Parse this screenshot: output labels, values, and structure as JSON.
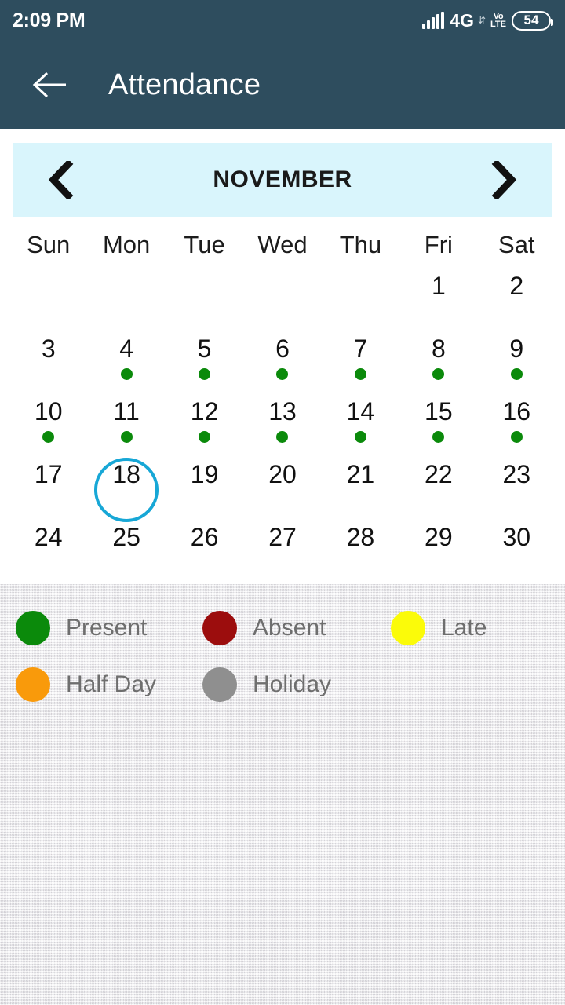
{
  "status_bar": {
    "time": "2:09 PM",
    "network_type": "4G",
    "volte_top": "Vo",
    "volte_bottom": "LTE",
    "battery_level": "54",
    "signal_icon": "signal-bars-icon",
    "data_arrows_icon": "data-transfer-icon"
  },
  "app_bar": {
    "title": "Attendance",
    "back_icon": "back-arrow-icon"
  },
  "calendar": {
    "month_label": "NOVEMBER",
    "prev_icon": "chevron-left-icon",
    "next_icon": "chevron-right-icon",
    "weekdays": [
      "Sun",
      "Mon",
      "Tue",
      "Wed",
      "Thu",
      "Fri",
      "Sat"
    ],
    "today": 18,
    "today_ring_color": "#17a7d6",
    "leading_blanks": 5,
    "days": [
      {
        "num": "1",
        "status": null
      },
      {
        "num": "2",
        "status": null
      },
      {
        "num": "3",
        "status": null
      },
      {
        "num": "4",
        "status": "present"
      },
      {
        "num": "5",
        "status": "present"
      },
      {
        "num": "6",
        "status": "present"
      },
      {
        "num": "7",
        "status": "present"
      },
      {
        "num": "8",
        "status": "present"
      },
      {
        "num": "9",
        "status": "present"
      },
      {
        "num": "10",
        "status": "present"
      },
      {
        "num": "11",
        "status": "present"
      },
      {
        "num": "12",
        "status": "present"
      },
      {
        "num": "13",
        "status": "present"
      },
      {
        "num": "14",
        "status": "present"
      },
      {
        "num": "15",
        "status": "present"
      },
      {
        "num": "16",
        "status": "present"
      },
      {
        "num": "17",
        "status": null
      },
      {
        "num": "18",
        "status": null
      },
      {
        "num": "19",
        "status": null
      },
      {
        "num": "20",
        "status": null
      },
      {
        "num": "21",
        "status": null
      },
      {
        "num": "22",
        "status": null
      },
      {
        "num": "23",
        "status": null
      },
      {
        "num": "24",
        "status": null
      },
      {
        "num": "25",
        "status": null
      },
      {
        "num": "26",
        "status": null
      },
      {
        "num": "27",
        "status": null
      },
      {
        "num": "28",
        "status": null
      },
      {
        "num": "29",
        "status": null
      },
      {
        "num": "30",
        "status": null
      }
    ]
  },
  "legend": {
    "rows": [
      [
        {
          "key": "present",
          "label": "Present",
          "color": "#0b8a0b"
        },
        {
          "key": "absent",
          "label": "Absent",
          "color": "#9c0d0d"
        },
        {
          "key": "late",
          "label": "Late",
          "color": "#fbfb09"
        }
      ],
      [
        {
          "key": "half_day",
          "label": "Half Day",
          "color": "#f99a0b"
        },
        {
          "key": "holiday",
          "label": "Holiday",
          "color": "#8f8f8f"
        }
      ]
    ]
  },
  "theme": {
    "app_bar_bg": "#2e4d5e",
    "month_bar_bg": "#d9f5fc",
    "calendar_bg": "#ffffff",
    "legend_bg": "#ebebec"
  }
}
